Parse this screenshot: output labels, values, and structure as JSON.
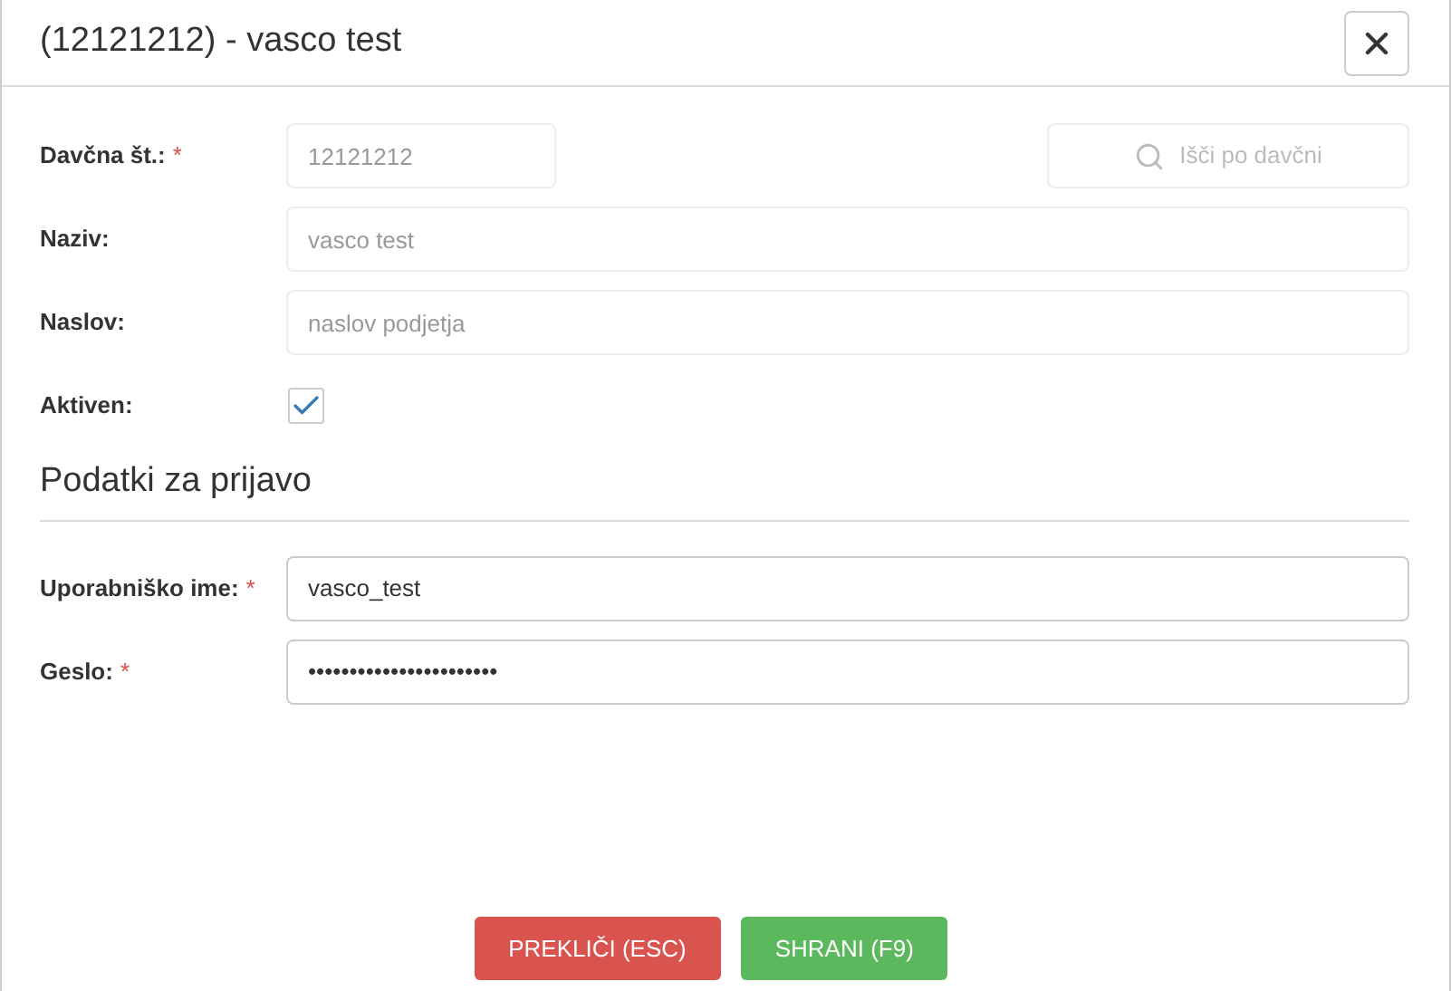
{
  "dialog": {
    "title": "(12121212) - vasco test"
  },
  "search": {
    "placeholder": "Išči po davčni"
  },
  "company_fields": [
    {
      "kind": "text",
      "label": "Davčna št.:",
      "required_mark": "*",
      "value": "12121212",
      "disabled": true,
      "wide": false
    },
    {
      "kind": "text",
      "label": "Naziv:",
      "value": "vasco test",
      "disabled": true,
      "wide": true
    },
    {
      "kind": "text",
      "label": "Naslov:",
      "placeholder": "naslov podjetja",
      "disabled": true,
      "wide": true
    },
    {
      "kind": "checkbox",
      "label": "Aktiven:",
      "checked": true
    }
  ],
  "section_title": "Podatki za prijavo",
  "login_fields": [
    {
      "kind": "text",
      "label": "Uporabniško ime:",
      "required_mark": "*",
      "value": "vasco_test",
      "disabled": false,
      "wide": true
    },
    {
      "kind": "text",
      "label": "Geslo:",
      "required_mark": "*",
      "value": "•••••••••••••••••••••••",
      "disabled": false,
      "wide": true
    }
  ],
  "buttons": [
    {
      "kind": "cancel",
      "label": "PREKLIČI (ESC)"
    },
    {
      "kind": "save",
      "label": "SHRANI (F9)"
    }
  ]
}
